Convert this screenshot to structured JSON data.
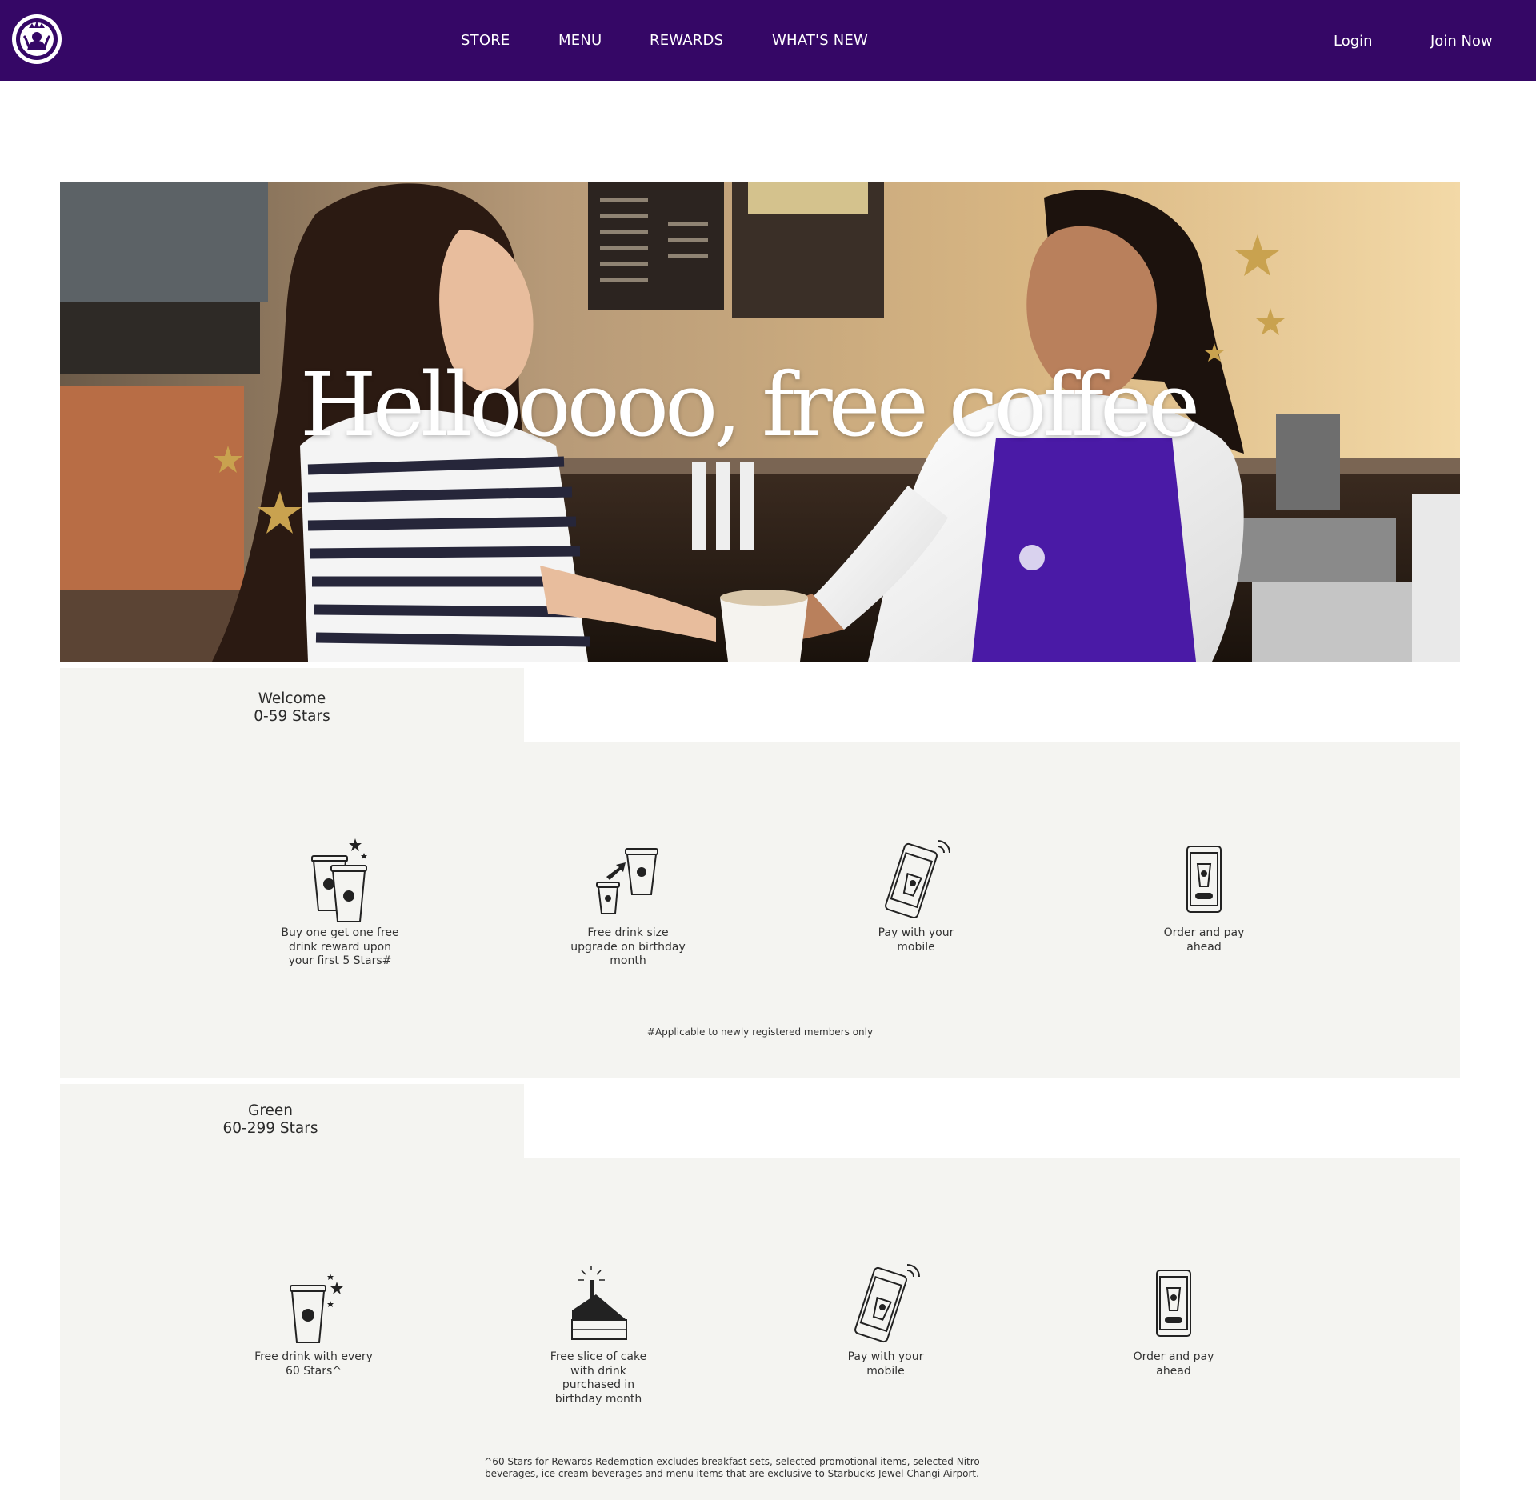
{
  "nav": {
    "links": [
      "STORE",
      "MENU",
      "REWARDS",
      "WHAT'S NEW"
    ],
    "login_label": "Login",
    "join_label": "Join Now",
    "brand_color": "#350766"
  },
  "hero": {
    "headline": "Hellooooo, free coffee"
  },
  "tiers": [
    {
      "name": "Welcome",
      "range": "0-59 Stars",
      "benefits": [
        {
          "label": "Buy one get one free\ndrink reward upon\nyour first 5 Stars#",
          "icon": "two-cups-stars-icon"
        },
        {
          "label": "Free drink size\nupgrade on birthday\nmonth",
          "icon": "cup-upgrade-icon"
        },
        {
          "label": "Pay with your\nmobile",
          "icon": "mobile-pay-icon"
        },
        {
          "label": "Order and pay\nahead",
          "icon": "mobile-order-icon"
        }
      ],
      "note": "#Applicable to newly registered members only"
    },
    {
      "name": "Green",
      "range": "60-299 Stars",
      "benefits": [
        {
          "label": "Free drink with every\n60 Stars^",
          "icon": "cup-stars-icon"
        },
        {
          "label": "Free slice of cake\nwith drink\npurchased in\nbirthday month",
          "icon": "birthday-cake-icon"
        },
        {
          "label": "Pay with your\nmobile",
          "icon": "mobile-pay-icon"
        },
        {
          "label": "Order and pay\nahead",
          "icon": "mobile-order-icon"
        }
      ],
      "note": "^60 Stars for Rewards Redemption excludes breakfast sets, selected promotional items, selected Nitro\nbeverages, ice cream beverages and menu items that are exclusive to Starbucks Jewel Changi Airport."
    }
  ]
}
